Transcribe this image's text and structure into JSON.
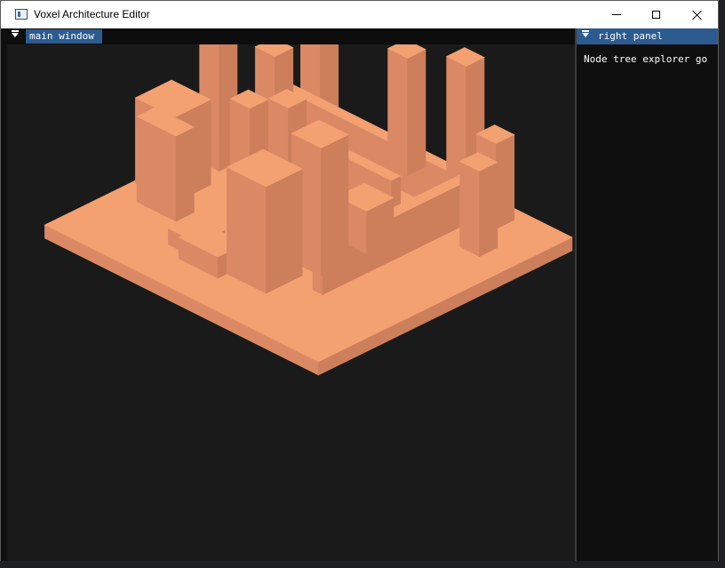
{
  "window": {
    "title": "Voxel Architecture Editor",
    "icon": "app-window-icon",
    "controls": [
      "minimize-icon",
      "maximize-icon",
      "close-icon"
    ]
  },
  "main_panel": {
    "tab_label": "main window",
    "scene": "3D voxel architecture model rendered on a flat square base"
  },
  "right_panel": {
    "tab_label": "right panel",
    "text": "Node tree explorer go"
  },
  "colors": {
    "tab_active": "#2c5b8f",
    "viewport_bg": "#1a1a1a",
    "voxel_top": "#f3a171",
    "voxel_left": "#db8965",
    "voxel_right": "#cd7f5c"
  }
}
